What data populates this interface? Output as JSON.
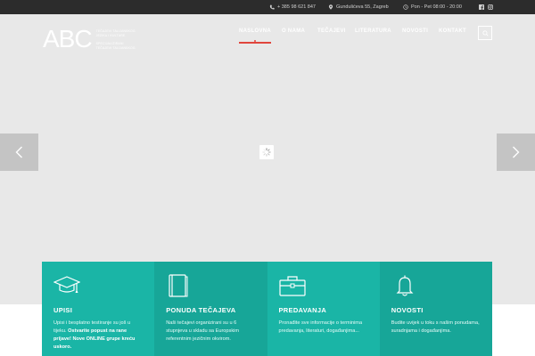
{
  "topbar": {
    "phone": "+ 385 98 621 847",
    "address": "Gundulićeva 55, Zagreb",
    "hours": "Pon - Pet 08:00 - 20:00"
  },
  "logo": {
    "mark": "ABC",
    "tag_line1": "Tečajevi talijanskog",
    "tag_line2": "jezika i kulture",
    "tag_line3": "Specijalizirani",
    "tag_line4": "tečajevi talijanskog"
  },
  "nav": {
    "items": [
      "NASLOVNA",
      "O NAMA",
      "TEČAJEVI",
      "LITERATURA",
      "NOVOSTI",
      "KONTAKT"
    ],
    "active": "NASLOVNA"
  },
  "features": [
    {
      "title": "UPISI",
      "text_plain": "Upisi i besplatno testiranje su još u tijeku. ",
      "text_bold": "Ostvarite popust na rane prijave! Nove ONLINE grupe kreću uskoro.",
      "icon": "graduation-cap-icon"
    },
    {
      "title": "PONUDA TEČAJEVA",
      "text_plain": "Naši tečajevi organizirani su u 6 stupnjeva u skladu sa Europskim referentnim jezičnim okvirom.",
      "icon": "book-icon"
    },
    {
      "title": "PREDAVANJA",
      "text_plain": "Pronađite sve informacije o terminima predavanja, literaturi, događanjima...",
      "icon": "briefcase-icon"
    },
    {
      "title": "NOVOSTI",
      "text_plain": "Budite uvijek u toku s našim ponudama, suradnjama i događanjima.",
      "icon": "bell-icon"
    }
  ],
  "colors": {
    "topbar": "#2c2c2c",
    "accent": "#e0453c",
    "teal": "#1ab5a6",
    "teal_dark": "#17a698"
  }
}
